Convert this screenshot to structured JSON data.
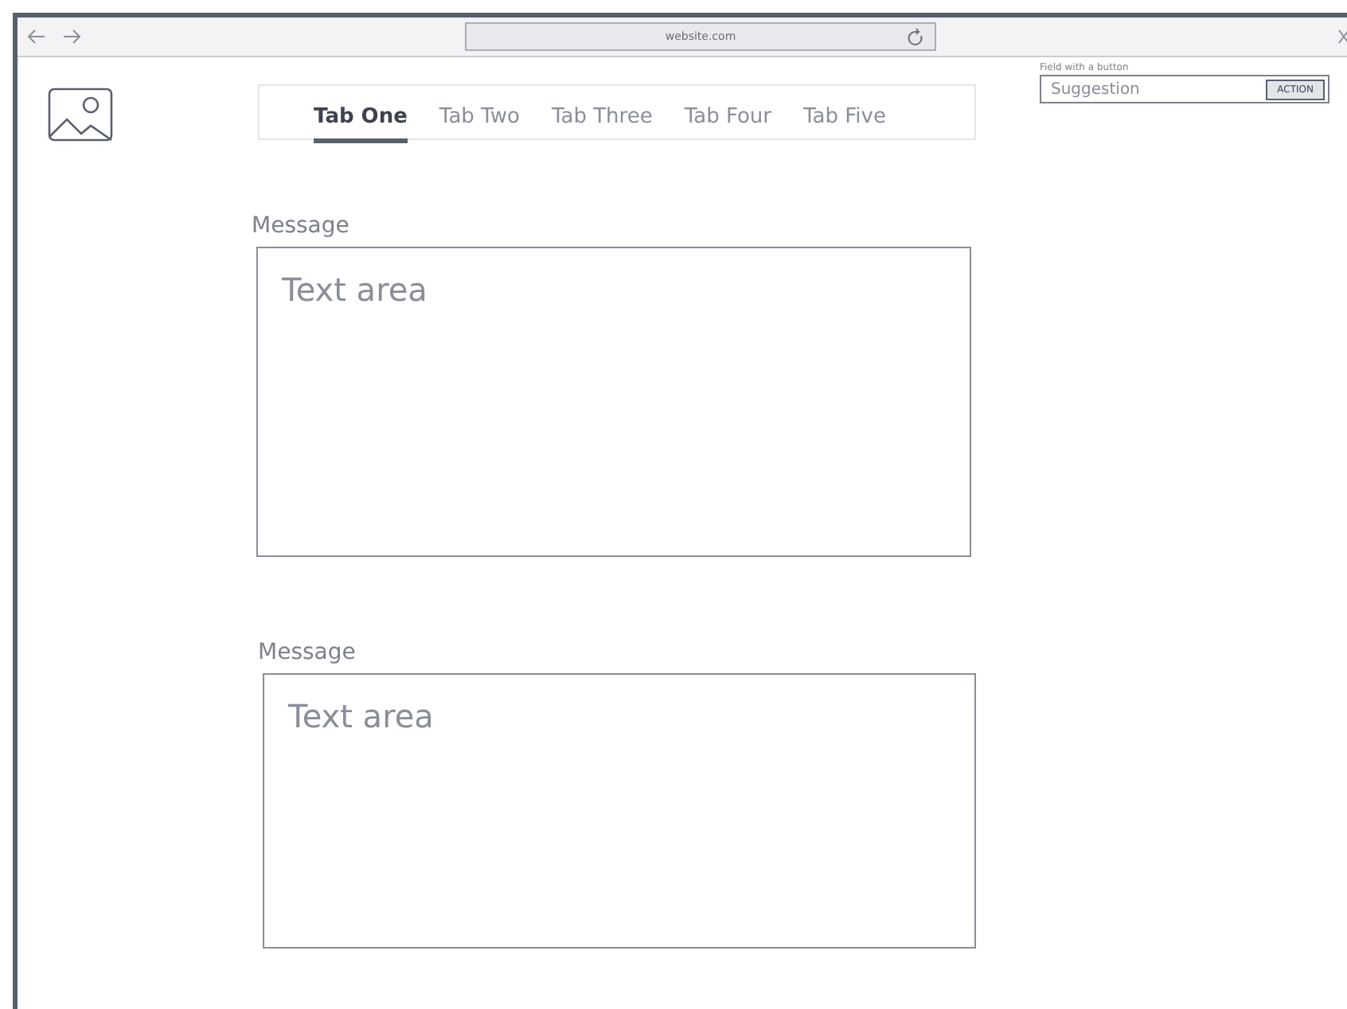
{
  "browser": {
    "url": "website.com"
  },
  "tabs": [
    {
      "label": "Tab One",
      "selected": true
    },
    {
      "label": "Tab Two",
      "selected": false
    },
    {
      "label": "Tab Three",
      "selected": false
    },
    {
      "label": "Tab Four",
      "selected": false
    },
    {
      "label": "Tab Five",
      "selected": false
    }
  ],
  "field_with_button": {
    "label": "Field with a button",
    "placeholder": "Suggestion",
    "button": "ACTION"
  },
  "messages": [
    {
      "label": "Message",
      "placeholder": "Text area"
    },
    {
      "label": "Message",
      "placeholder": "Text area"
    }
  ]
}
